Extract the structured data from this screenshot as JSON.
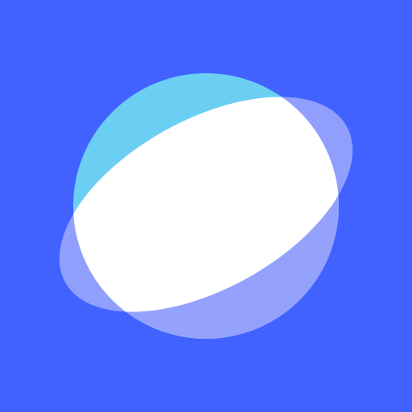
{
  "app_icon": {
    "icon": "planet-icon",
    "colors": {
      "background": "#4262FF",
      "planet_top": "#6ACFF3",
      "planet_bottom": "#94A2FD",
      "ring": "#FFFFFF"
    }
  }
}
